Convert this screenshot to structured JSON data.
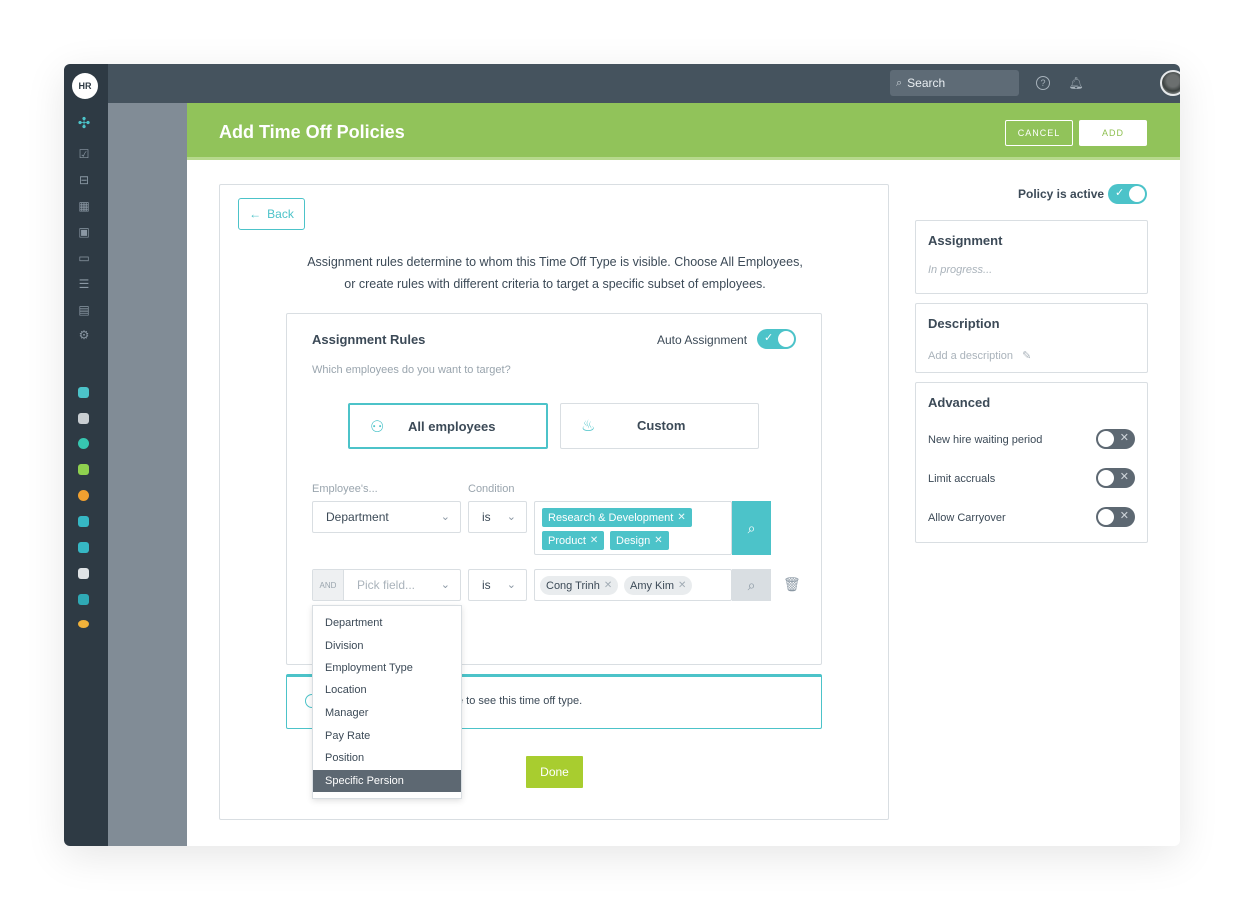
{
  "rail": {
    "logo": "HR"
  },
  "topbar": {
    "search_placeholder": "Search"
  },
  "header": {
    "title": "Add Time Off Policies",
    "cancel_label": "CANCEL",
    "add_label": "ADD"
  },
  "card": {
    "back_label": "Back",
    "intro_line1": "Assignment rules determine to whom this Time Off Type is visible. Choose All Employees,",
    "intro_line2": "or create rules with different criteria to target a specific subset of employees.",
    "rules": {
      "title": "Assignment Rules",
      "auto_label": "Auto Assignment",
      "auto_on": true,
      "subtitle": "Which employees do you want to target?",
      "choices": [
        "All employees",
        "Custom"
      ],
      "selected_choice": "All employees",
      "col_employee": "Employee's...",
      "col_condition": "Condition",
      "row1": {
        "field": "Department",
        "condition": "is",
        "tags": [
          "Research & Development",
          "Product",
          "Design"
        ]
      },
      "row2": {
        "joiner": "AND",
        "field_placeholder": "Pick field...",
        "condition": "is",
        "tags": [
          "Cong Trinh",
          "Amy Kim"
        ]
      }
    },
    "dropdown": {
      "options": [
        "Department",
        "Division",
        "Employment Type",
        "Location",
        "Manager",
        "Pay Rate",
        "Position",
        "Specific Persion"
      ],
      "highlighted": "Specific Persion"
    },
    "info_text": "e to see this time off type.",
    "done_label": "Done"
  },
  "side": {
    "policy_active_label": "Policy is active",
    "policy_active": true,
    "assignment": {
      "title": "Assignment",
      "status": "In progress..."
    },
    "description": {
      "title": "Description",
      "placeholder": "Add a description"
    },
    "advanced": {
      "title": "Advanced",
      "options": [
        {
          "label": "New hire waiting period",
          "on": false
        },
        {
          "label": "Limit accruals",
          "on": false
        },
        {
          "label": "Allow Carryover",
          "on": false
        }
      ]
    }
  },
  "colors": {
    "accent": "#4cc3c9",
    "header_green": "#91c35a",
    "done_green": "#a8cd2f",
    "rail": "#2e3a44"
  }
}
